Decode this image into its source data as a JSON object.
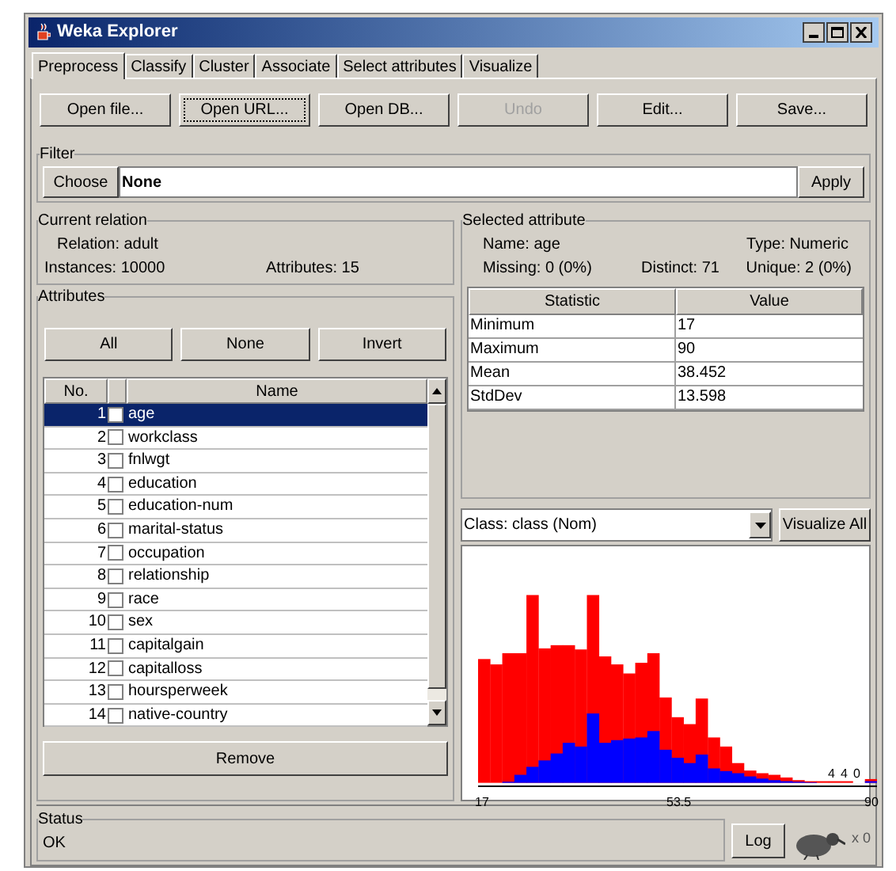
{
  "window": {
    "title": "Weka Explorer"
  },
  "tabs": [
    {
      "label": "Preprocess",
      "selected": true
    },
    {
      "label": "Classify",
      "selected": false
    },
    {
      "label": "Cluster",
      "selected": false
    },
    {
      "label": "Associate",
      "selected": false
    },
    {
      "label": "Select attributes",
      "selected": false
    },
    {
      "label": "Visualize",
      "selected": false
    }
  ],
  "toolbar_buttons": [
    {
      "label": "Open file...",
      "disabled": false,
      "focused": false
    },
    {
      "label": "Open URL...",
      "disabled": false,
      "focused": true
    },
    {
      "label": "Open DB...",
      "disabled": false,
      "focused": false
    },
    {
      "label": "Undo",
      "disabled": true,
      "focused": false
    },
    {
      "label": "Edit...",
      "disabled": false,
      "focused": false
    },
    {
      "label": "Save...",
      "disabled": false,
      "focused": false
    }
  ],
  "filter": {
    "title": "Filter",
    "choose": "Choose",
    "value": "None",
    "apply": "Apply"
  },
  "current_relation": {
    "title": "Current relation",
    "relation": "Relation: adult",
    "instances": "Instances: 10000",
    "attributes": "Attributes: 15"
  },
  "attributes": {
    "title": "Attributes",
    "buttons": [
      "All",
      "None",
      "Invert"
    ],
    "columns": [
      "No.",
      "Name"
    ],
    "rows": [
      {
        "no": "1",
        "name": "age",
        "checked": false,
        "selected": true
      },
      {
        "no": "2",
        "name": "workclass",
        "checked": false,
        "selected": false
      },
      {
        "no": "3",
        "name": "fnlwgt",
        "checked": false,
        "selected": false
      },
      {
        "no": "4",
        "name": "education",
        "checked": false,
        "selected": false
      },
      {
        "no": "5",
        "name": "education-num",
        "checked": false,
        "selected": false
      },
      {
        "no": "6",
        "name": "marital-status",
        "checked": false,
        "selected": false
      },
      {
        "no": "7",
        "name": "occupation",
        "checked": false,
        "selected": false
      },
      {
        "no": "8",
        "name": "relationship",
        "checked": false,
        "selected": false
      },
      {
        "no": "9",
        "name": "race",
        "checked": false,
        "selected": false
      },
      {
        "no": "10",
        "name": "sex",
        "checked": false,
        "selected": false
      },
      {
        "no": "11",
        "name": "capitalgain",
        "checked": false,
        "selected": false
      },
      {
        "no": "12",
        "name": "capitalloss",
        "checked": false,
        "selected": false
      },
      {
        "no": "13",
        "name": "hoursperweek",
        "checked": false,
        "selected": false
      },
      {
        "no": "14",
        "name": "native-country",
        "checked": false,
        "selected": false
      }
    ],
    "remove": "Remove"
  },
  "selected_attribute": {
    "title": "Selected attribute",
    "name": "Name: age",
    "type": "Type: Numeric",
    "missing": "Missing: 0 (0%)",
    "distinct": "Distinct: 71",
    "unique": "Unique: 2 (0%)",
    "columns": [
      "Statistic",
      "Value"
    ],
    "rows": [
      {
        "statistic": "Minimum",
        "value": "17"
      },
      {
        "statistic": "Maximum",
        "value": "90"
      },
      {
        "statistic": "Mean",
        "value": "38.452"
      },
      {
        "statistic": "StdDev",
        "value": "13.598"
      }
    ]
  },
  "class_selector": {
    "value": "Class: class (Nom)"
  },
  "visualize_all": "Visualize All",
  "histogram": {
    "bar_labels": [
      "4",
      "4",
      "0"
    ],
    "x_ticks": [
      "17",
      "53.5",
      "90"
    ]
  },
  "status": {
    "title": "Status",
    "text": "OK",
    "log": "Log",
    "count": "x 0"
  }
}
